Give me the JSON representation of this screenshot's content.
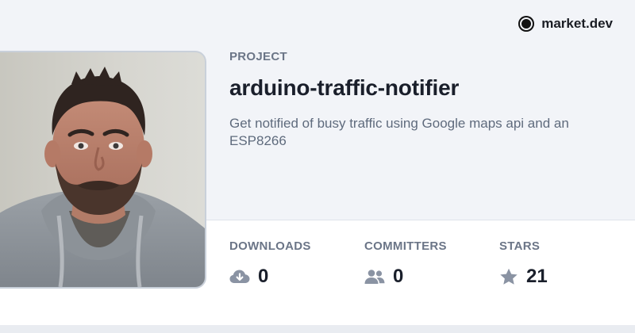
{
  "brand": {
    "name": "market.dev",
    "logo_icon": "market-dev-logo-icon"
  },
  "project": {
    "kicker": "PROJECT",
    "title": "arduino-traffic-notifier",
    "description": "Get notified of busy traffic using Google maps api and an ESP8266"
  },
  "stats": {
    "downloads": {
      "label": "DOWNLOADS",
      "value": "0",
      "icon": "cloud-download-icon"
    },
    "committers": {
      "label": "COMMITTERS",
      "value": "0",
      "icon": "users-icon"
    },
    "stars": {
      "label": "STARS",
      "value": "21",
      "icon": "star-icon"
    }
  },
  "colors": {
    "background": "#f2f4f8",
    "panel": "#ffffff",
    "text_primary": "#1a1f2b",
    "text_muted": "#6b7587",
    "icon_muted": "#8a93a3"
  }
}
